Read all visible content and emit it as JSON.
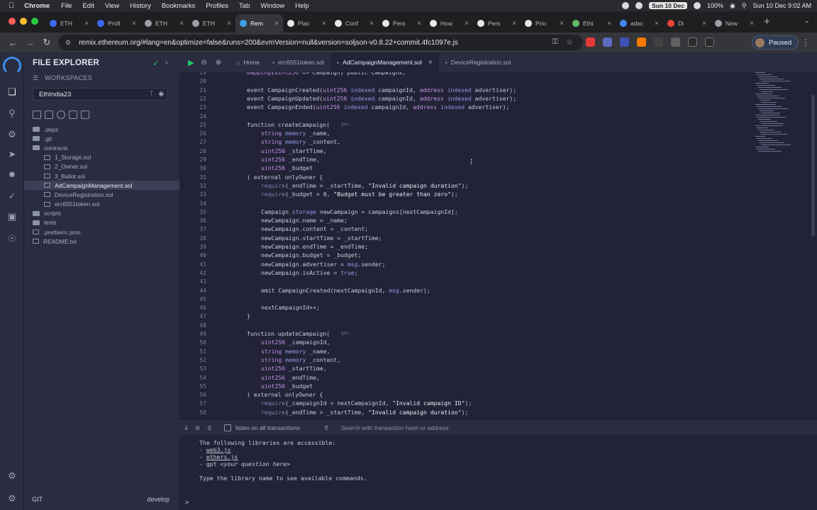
{
  "menubar": {
    "app": "Chrome",
    "items": [
      "File",
      "Edit",
      "View",
      "History",
      "Bookmarks",
      "Profiles",
      "Tab",
      "Window",
      "Help"
    ],
    "date_badge": "Sun 10 Dec",
    "battery": "100%",
    "clock": "Sun 10 Dec  9:02 AM"
  },
  "tabs": [
    {
      "label": "ETH",
      "color": "#3b6cf0"
    },
    {
      "label": "Profi",
      "color": "#3b6cf0"
    },
    {
      "label": "ETH",
      "color": "#9aa0a6"
    },
    {
      "label": "ETH",
      "color": "#9aa0a6"
    },
    {
      "label": "Rem",
      "color": "#3fa0e8",
      "active": true
    },
    {
      "label": "Plac",
      "color": "#e8e8e8"
    },
    {
      "label": "Conf",
      "color": "#e8e8e8"
    },
    {
      "label": "Pers",
      "color": "#e8e8e8"
    },
    {
      "label": "How",
      "color": "#e8e8e8"
    },
    {
      "label": "Pers",
      "color": "#e8e8e8"
    },
    {
      "label": "Prio",
      "color": "#e8e8e8"
    },
    {
      "label": "Ethi",
      "color": "#66bb6a"
    },
    {
      "label": "adsc",
      "color": "#4285f4"
    },
    {
      "label": "Di",
      "color": "#ea4335"
    },
    {
      "label": "New",
      "color": "#9aa0a6"
    }
  ],
  "address": {
    "url": "remix.ethereum.org/#lang=en&optimize=false&runs=200&evmVersion=null&version=soljson-v0.8.22+commit.4fc1097e.js",
    "profile_label": "Paused"
  },
  "explorer": {
    "title": "FILE EXPLORER",
    "workspaces_label": "WORKSPACES",
    "workspace": "EthIndia23",
    "tree": [
      {
        "name": ".deps",
        "type": "folder",
        "indent": 0
      },
      {
        "name": ".git",
        "type": "folder",
        "indent": 0
      },
      {
        "name": "contracts",
        "type": "folder",
        "indent": 0
      },
      {
        "name": "1_Storage.sol",
        "type": "file",
        "indent": 1
      },
      {
        "name": "2_Owner.sol",
        "type": "file",
        "indent": 1
      },
      {
        "name": "3_Ballot.sol",
        "type": "file",
        "indent": 1
      },
      {
        "name": "AdCampaignManagement.sol",
        "type": "file",
        "indent": 1,
        "selected": true
      },
      {
        "name": "DeviceRegistration.sol",
        "type": "file",
        "indent": 1
      },
      {
        "name": "erc6551token.sol",
        "type": "file",
        "indent": 1
      },
      {
        "name": "scripts",
        "type": "folder",
        "indent": 0
      },
      {
        "name": "tests",
        "type": "folder",
        "indent": 0
      },
      {
        "name": ".prettierrc.json",
        "type": "file",
        "indent": 0
      },
      {
        "name": "README.txt",
        "type": "file",
        "indent": 0
      }
    ],
    "git_label": "GIT",
    "branch": "develop"
  },
  "editor": {
    "home_tab": "Home",
    "tabs": [
      {
        "label": "erc6551token.sol",
        "active": false,
        "closable": false
      },
      {
        "label": "AdCampaignManagement.sol",
        "active": true,
        "closable": true
      },
      {
        "label": "DeviceRegistration.sol",
        "active": false,
        "closable": false
      }
    ],
    "gas_hint": "gas",
    "lines": [
      {
        "n": "19",
        "indent": 4,
        "text": "mapping(uint256 => Campaign) public campaigns;"
      },
      {
        "n": "20",
        "indent": 0,
        "text": ""
      },
      {
        "n": "21",
        "indent": 4,
        "text": "event CampaignCreated(uint256 indexed campaignId, address indexed advertiser);"
      },
      {
        "n": "22",
        "indent": 4,
        "text": "event CampaignUpdated(uint256 indexed campaignId, address indexed advertiser);"
      },
      {
        "n": "23",
        "indent": 4,
        "text": "event CampaignEnded(uint256 indexed campaignId, address indexed advertiser);"
      },
      {
        "n": "24",
        "indent": 0,
        "text": ""
      },
      {
        "n": "25",
        "indent": 4,
        "text": "function createCampaign(",
        "gas": true
      },
      {
        "n": "26",
        "indent": 8,
        "text": "string memory _name,"
      },
      {
        "n": "27",
        "indent": 8,
        "text": "string memory _content,"
      },
      {
        "n": "28",
        "indent": 8,
        "text": "uint256 _startTime,"
      },
      {
        "n": "29",
        "indent": 8,
        "text": "uint256 _endTime,"
      },
      {
        "n": "30",
        "indent": 8,
        "text": "uint256 _budget"
      },
      {
        "n": "31",
        "indent": 4,
        "text": ") external onlyOwner {"
      },
      {
        "n": "32",
        "indent": 8,
        "text": "require(_endTime > _startTime, \"Invalid campaign duration\");"
      },
      {
        "n": "33",
        "indent": 8,
        "text": "require(_budget > 0, \"Budget must be greater than zero\");"
      },
      {
        "n": "34",
        "indent": 0,
        "text": ""
      },
      {
        "n": "35",
        "indent": 8,
        "text": "Campaign storage newCampaign = campaigns[nextCampaignId];"
      },
      {
        "n": "36",
        "indent": 8,
        "text": "newCampaign.name = _name;"
      },
      {
        "n": "37",
        "indent": 8,
        "text": "newCampaign.content = _content;"
      },
      {
        "n": "38",
        "indent": 8,
        "text": "newCampaign.startTime = _startTime;"
      },
      {
        "n": "39",
        "indent": 8,
        "text": "newCampaign.endTime = _endTime;"
      },
      {
        "n": "40",
        "indent": 8,
        "text": "newCampaign.budget = _budget;"
      },
      {
        "n": "41",
        "indent": 8,
        "text": "newCampaign.advertiser = msg.sender;"
      },
      {
        "n": "42",
        "indent": 8,
        "text": "newCampaign.isActive = true;"
      },
      {
        "n": "43",
        "indent": 0,
        "text": ""
      },
      {
        "n": "44",
        "indent": 8,
        "text": "emit CampaignCreated(nextCampaignId, msg.sender);"
      },
      {
        "n": "45",
        "indent": 0,
        "text": ""
      },
      {
        "n": "46",
        "indent": 8,
        "text": "nextCampaignId++;"
      },
      {
        "n": "47",
        "indent": 4,
        "text": "}"
      },
      {
        "n": "48",
        "indent": 0,
        "text": ""
      },
      {
        "n": "49",
        "indent": 4,
        "text": "function updateCampaign(",
        "gas": true
      },
      {
        "n": "50",
        "indent": 8,
        "text": "uint256 _campaignId,"
      },
      {
        "n": "51",
        "indent": 8,
        "text": "string memory _name,"
      },
      {
        "n": "52",
        "indent": 8,
        "text": "string memory _content,"
      },
      {
        "n": "53",
        "indent": 8,
        "text": "uint256 _startTime,"
      },
      {
        "n": "54",
        "indent": 8,
        "text": "uint256 _endTime,"
      },
      {
        "n": "55",
        "indent": 8,
        "text": "uint256 _budget"
      },
      {
        "n": "56",
        "indent": 4,
        "text": ") external onlyOwner {"
      },
      {
        "n": "57",
        "indent": 8,
        "text": "require(_campaignId < nextCampaignId, \"Invalid campaign ID\");"
      },
      {
        "n": "58",
        "indent": 8,
        "text": "require(_endTime > _startTime, \"Invalid campaign duration\");"
      }
    ]
  },
  "terminal": {
    "count": "0",
    "listen_label": "listen on all transactions",
    "search_placeholder": "Search with transaction hash or address",
    "intro": "The following libraries are accessible:",
    "libs": [
      "web3.js",
      "ethers.js"
    ],
    "gpt_prefix": "gpt ",
    "gpt_hint": "<your question here>",
    "hint": "Type the library name to see available commands.",
    "prompt": ">"
  },
  "colors": {
    "accent": "#1ecb6a",
    "remix_blue": "#3f8ee8",
    "background": "#222336",
    "panel": "#2a2c3f"
  }
}
